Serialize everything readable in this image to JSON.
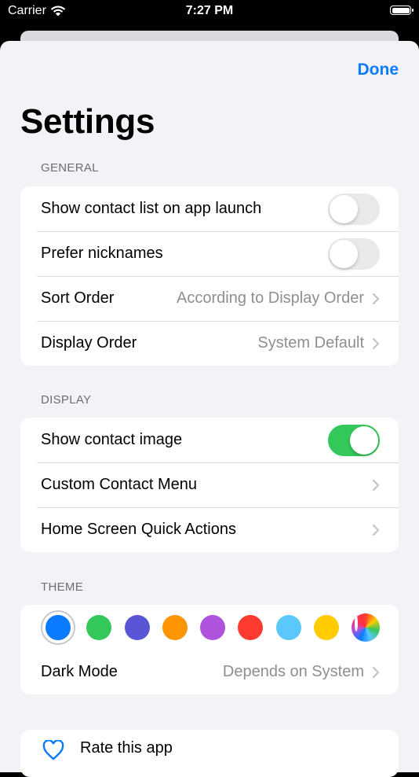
{
  "status_bar": {
    "carrier": "Carrier",
    "time": "7:27 PM"
  },
  "nav": {
    "done_label": "Done"
  },
  "page": {
    "title": "Settings"
  },
  "general": {
    "header": "GENERAL",
    "rows": [
      {
        "label": "Show contact list on app launch",
        "toggle": false
      },
      {
        "label": "Prefer nicknames",
        "toggle": false
      },
      {
        "label": "Sort Order",
        "value": "According to Display Order"
      },
      {
        "label": "Display Order",
        "value": "System Default"
      }
    ]
  },
  "display": {
    "header": "DISPLAY",
    "rows": [
      {
        "label": "Show contact image",
        "toggle": true
      },
      {
        "label": "Custom Contact Menu"
      },
      {
        "label": "Home Screen Quick Actions"
      }
    ]
  },
  "theme": {
    "header": "THEME",
    "colors": [
      "#0a7aff",
      "#34c759",
      "#5856d6",
      "#ff9500",
      "#af52de",
      "#ff3b30",
      "#5ac8fa",
      "#ffcc00",
      "#0a7aff"
    ],
    "selected_index": 0,
    "dark_mode": {
      "label": "Dark Mode",
      "value": "Depends on System"
    }
  },
  "bottom": {
    "label": "Rate this app",
    "icon": "heart-icon"
  },
  "colors": {
    "accent": "#0a7aff",
    "toggle_on": "#34c759",
    "background": "#f2f2f7"
  }
}
